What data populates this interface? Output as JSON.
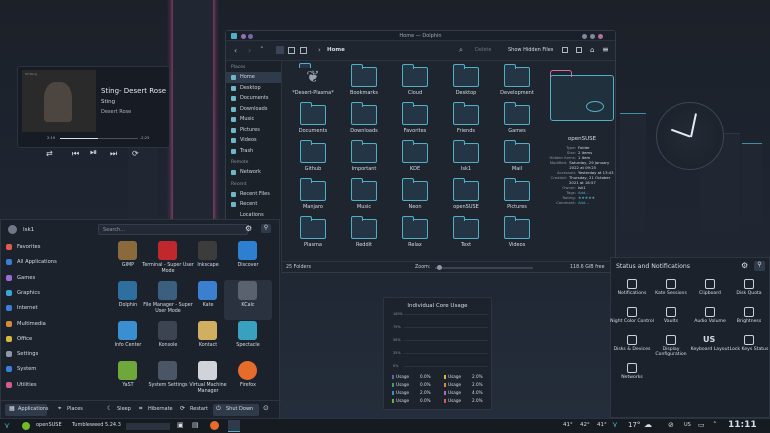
{
  "media": {
    "track": "Sting- Desert Rose",
    "artist": "Sting",
    "album": "Desert Rose",
    "elapsed": "2:19",
    "remaining": "-2:25",
    "progress": 0.49,
    "cover_label": "ST.Sting"
  },
  "dolphin": {
    "title": "Home — Dolphin",
    "breadcrumb": "Home",
    "delete": "Delete",
    "show_hidden": "Show Hidden Files",
    "places_header": "Places",
    "places": [
      "Home",
      "Desktop",
      "Documents",
      "Downloads",
      "Music",
      "Pictures",
      "Videos",
      "Trash"
    ],
    "remote_header": "Remote",
    "remote": [
      "Network"
    ],
    "recent_header": "Recent",
    "recent": [
      "Recent Files",
      "Recent Locations"
    ],
    "folders": [
      "*Desert-Plasma*",
      "Bookmarks",
      "Cloud",
      "Desktop",
      "Development",
      "Documents",
      "Downloads",
      "Favorites",
      "Friends",
      "Games",
      "Github",
      "Important",
      "KDE",
      "Isk1",
      "Mail",
      "Manjaro",
      "Music",
      "Neon",
      "openSUSE",
      "Pictures",
      "Plasma",
      "Reddit",
      "Relax",
      "Text",
      "Videos"
    ],
    "info_title": "openSUSE",
    "info": [
      [
        "Type:",
        "Folder"
      ],
      [
        "Size:",
        "2 items"
      ],
      [
        "Hidden items:",
        "1 item"
      ],
      [
        "Modified:",
        "Saturday, 29 January 2022 at 09:25"
      ],
      [
        "Accessed:",
        "Yesterday at 13:43"
      ],
      [
        "Created:",
        "Thursday, 21 October 2021 at 18:57"
      ],
      [
        "Owner:",
        "Isk1"
      ],
      [
        "Tags:",
        "Add..."
      ],
      [
        "Rating:",
        "★★★★★"
      ],
      [
        "Comment:",
        "Add..."
      ]
    ],
    "status": "25 Folders",
    "zoom_label": "Zoom:",
    "free": "118.6 GiB free"
  },
  "launcher": {
    "user": "Isk1",
    "search_placeholder": "Search...",
    "categories": [
      "Favorites",
      "All Applications",
      "Games",
      "Graphics",
      "Internet",
      "Multimedia",
      "Office",
      "Settings",
      "System",
      "Utilities"
    ],
    "apps": [
      "GIMP",
      "Terminal - Super User Mode",
      "Inkscape",
      "Discover",
      "Dolphin",
      "File Manager - Super User Mode",
      "Kate",
      "KCalc",
      "Info Center",
      "Konsole",
      "Kontact",
      "Spectacle",
      "YaST",
      "System Settings",
      "Virtual Machine Manager",
      "Firefox"
    ],
    "tabs": [
      "Applications",
      "Places"
    ],
    "power": [
      "Sleep",
      "Hibernate",
      "Restart",
      "Shut Down"
    ]
  },
  "core": {
    "title": "Individual Core Usage",
    "yticks": [
      "100%",
      "75%",
      "50%",
      "25%",
      "0%"
    ],
    "rows": [
      [
        "Usage",
        "0.0%",
        "Usage",
        "2.0%"
      ],
      [
        "Usage",
        "0.0%",
        "Usage",
        "2.0%"
      ],
      [
        "Usage",
        "2.0%",
        "Usage",
        "4.0%"
      ],
      [
        "Usage",
        "0.0%",
        "Usage",
        "2.0%"
      ]
    ]
  },
  "status": {
    "title": "Status and Notifications",
    "items": [
      "Notifications",
      "Kate Sessions",
      "Clipboard",
      "Disk Quota",
      "Night Color Control",
      "Vaults",
      "Audio Volume",
      "Brightness",
      "Disks & Devices",
      "Display Configuration",
      "Keyboard Layout",
      "Lock Keys Status",
      "Networks"
    ],
    "kb_glyph": "US"
  },
  "taskbar": {
    "os": "openSUSE",
    "kernel": "Tumbleweed 5.24.3",
    "temps": [
      "41°",
      "42°",
      "41°"
    ],
    "weather": "17°",
    "time": "11:11",
    "tray_kb": "US"
  },
  "colors": {
    "accent": "#4fb0c4",
    "neon": "#e06aa8",
    "bg": "#1d2430"
  }
}
